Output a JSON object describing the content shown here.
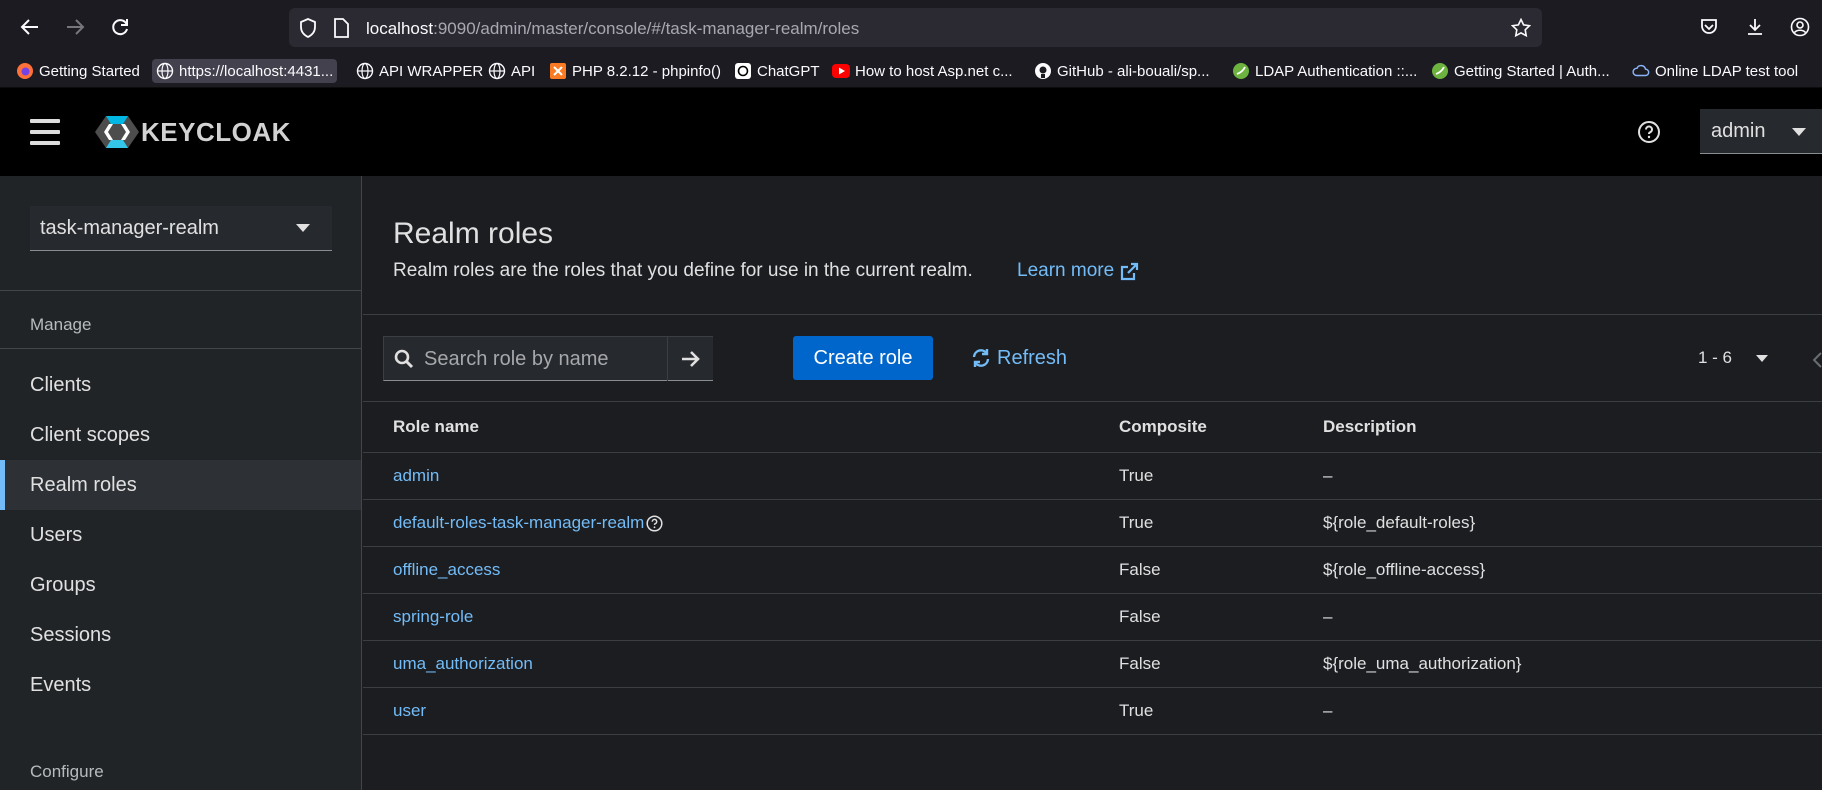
{
  "browser": {
    "url_host": "localhost",
    "url_rest": ":9090/admin/master/console/#/task-manager-realm/roles",
    "bookmarks": [
      {
        "label": "Getting Started",
        "icon": "firefox-icon"
      },
      {
        "label": "https://localhost:4431...",
        "icon": "globe-icon"
      },
      {
        "label": "API WRAPPER",
        "icon": "globe-icon"
      },
      {
        "label": "API",
        "icon": "globe-icon"
      },
      {
        "label": "PHP 8.2.12 - phpinfo()",
        "icon": "xampp-icon"
      },
      {
        "label": "ChatGPT",
        "icon": "chatgpt-icon"
      },
      {
        "label": "How to host Asp.net c...",
        "icon": "youtube-icon"
      },
      {
        "label": "GitHub - ali-bouali/sp...",
        "icon": "github-icon"
      },
      {
        "label": "LDAP Authentication ::...",
        "icon": "spring-icon"
      },
      {
        "label": "Getting Started | Auth...",
        "icon": "spring-icon"
      },
      {
        "label": "Online LDAP test tool",
        "icon": "cloud-icon"
      }
    ]
  },
  "header": {
    "logo_text": "KEYCLOAK",
    "user": "admin"
  },
  "sidebar": {
    "realm": "task-manager-realm",
    "manage_label": "Manage",
    "configure_label": "Configure",
    "items": [
      {
        "label": "Clients",
        "active": false
      },
      {
        "label": "Client scopes",
        "active": false
      },
      {
        "label": "Realm roles",
        "active": true
      },
      {
        "label": "Users",
        "active": false
      },
      {
        "label": "Groups",
        "active": false
      },
      {
        "label": "Sessions",
        "active": false
      },
      {
        "label": "Events",
        "active": false
      }
    ]
  },
  "main": {
    "title": "Realm roles",
    "description": "Realm roles are the roles that you define for use in the current realm.",
    "learn_more": "Learn more",
    "search_placeholder": "Search role by name",
    "create_label": "Create role",
    "refresh_label": "Refresh",
    "pagination": "1 - 6",
    "columns": [
      "Role name",
      "Composite",
      "Description"
    ],
    "rows": [
      {
        "name": "admin",
        "composite": "True",
        "description": "–"
      },
      {
        "name": "default-roles-task-manager-realm",
        "composite": "True",
        "description": "${role_default-roles}"
      },
      {
        "name": "offline_access",
        "composite": "False",
        "description": "${role_offline-access}"
      },
      {
        "name": "spring-role",
        "composite": "False",
        "description": "–"
      },
      {
        "name": "uma_authorization",
        "composite": "False",
        "description": "${role_uma_authorization}"
      },
      {
        "name": "user",
        "composite": "True",
        "description": "–"
      }
    ]
  },
  "colors": {
    "accent": "#73bcf7",
    "primary_button": "#0066cc",
    "header_bg": "#000000",
    "sidebar_bg": "#212427",
    "main_bg": "#1b1d21"
  }
}
